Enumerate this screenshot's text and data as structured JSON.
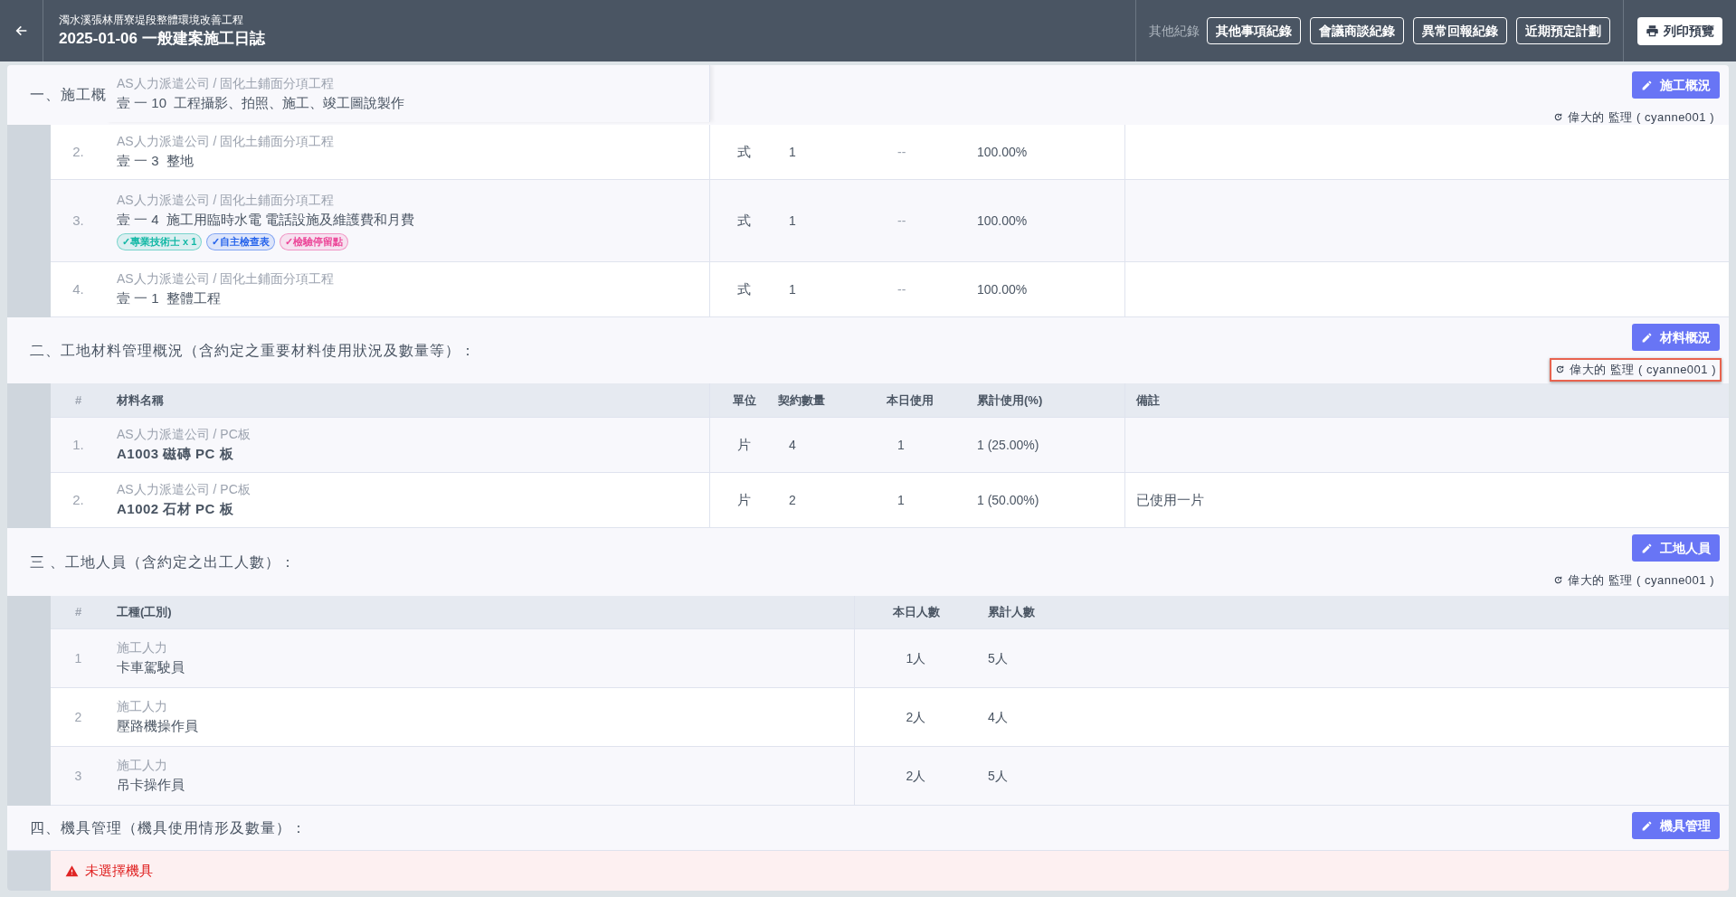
{
  "header": {
    "project": "濁水溪張林厝寮堤段整體環境改善工程",
    "title": "2025-01-06 一般建案施工日誌",
    "other_records_label": "其他紀錄",
    "record_buttons": [
      "其他事項紀錄",
      "會議商談紀錄",
      "異常回報紀錄",
      "近期預定計劃"
    ],
    "print_button": "列印預覽"
  },
  "sections": [
    {
      "kind": "tasks",
      "title": "一、施工概",
      "edit_button": "施工概況",
      "author": {
        "name": "偉大的 監理 ( cyanne001 )",
        "highlighted": false
      },
      "floating_row": {
        "category": "AS人力派遣公司 / 固化土鋪面分項工程",
        "name": "壹 一 10  工程攝影、拍照、施工、竣工圖說製作"
      },
      "rows": [
        {
          "index": "2.",
          "category": "AS人力派遣公司 / 固化土鋪面分項工程",
          "name": "壹 一 3  整地",
          "unit": "式",
          "quantity": "1",
          "today": "--",
          "progress": "100.00%"
        },
        {
          "index": "3.",
          "category": "AS人力派遣公司 / 固化土鋪面分項工程",
          "name": "壹 一 4  施工用臨時水電 電話設施及維護費和月費",
          "tags": [
            {
              "label": "✓專業技術士 x 1",
              "color": "#14b8a6"
            },
            {
              "label": "✓自主檢查表",
              "color": "#2563eb"
            },
            {
              "label": "✓檢驗停留點",
              "color": "#ec4899"
            }
          ],
          "unit": "式",
          "quantity": "1",
          "today": "--",
          "progress": "100.00%"
        },
        {
          "index": "4.",
          "category": "AS人力派遣公司 / 固化土鋪面分項工程",
          "name": "壹 一 1  整體工程",
          "unit": "式",
          "quantity": "1",
          "today": "--",
          "progress": "100.00%"
        }
      ]
    },
    {
      "kind": "materials",
      "title": "二、工地材料管理概況（含約定之重要材料使用狀況及數量等）：",
      "edit_button": "材料概況",
      "author": {
        "name": "偉大的 監理 ( cyanne001 )",
        "highlighted": true
      },
      "columns": [
        "#",
        "材料名稱",
        "單位",
        "契約數量",
        "本日使用",
        "累計使用(%)",
        "備註"
      ],
      "rows": [
        {
          "index": "1.",
          "category": "AS人力派遣公司 / PC板",
          "name": "A1003 磁磚 PC 板",
          "unit": "片",
          "quantity": "4",
          "today": "1",
          "progress": "1 (25.00%)"
        },
        {
          "index": "2.",
          "category": "AS人力派遣公司 / PC板",
          "name": "A1002 石材 PC 板",
          "unit": "片",
          "quantity": "2",
          "today": "1",
          "progress": "1 (50.00%)",
          "remark": "已使用一片"
        }
      ]
    },
    {
      "kind": "workers",
      "title": "三 、工地人員（含約定之出工人數）：",
      "edit_button": "工地人員",
      "author": {
        "name": "偉大的 監理 ( cyanne001 )",
        "highlighted": false
      },
      "columns": [
        "#",
        "工種(工別)",
        "本日人數",
        "累計人數"
      ],
      "rows": [
        {
          "index": "1",
          "category": "施工人力",
          "name": "卡車駕駛員",
          "today": "1人",
          "total": "5人"
        },
        {
          "index": "2",
          "category": "施工人力",
          "name": "壓路機操作員",
          "today": "2人",
          "total": "4人"
        },
        {
          "index": "3",
          "category": "施工人力",
          "name": "吊卡操作員",
          "today": "2人",
          "total": "5人"
        }
      ]
    },
    {
      "kind": "equipment",
      "title": "四、機具管理（機具使用情形及數量）：",
      "edit_button": "機具管理",
      "alert": "未選擇機具"
    }
  ]
}
